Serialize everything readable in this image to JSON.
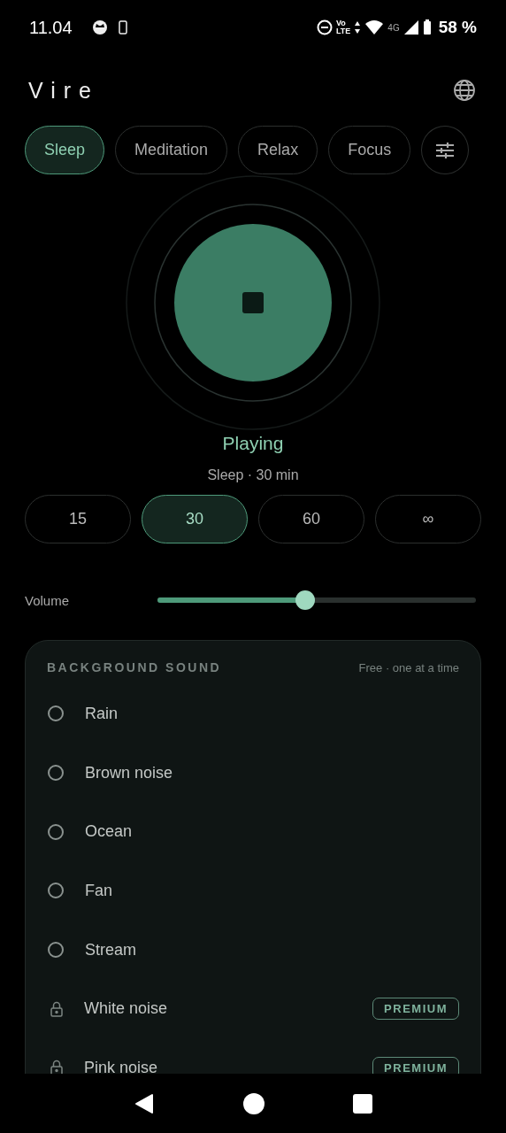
{
  "status_bar": {
    "time": "11.04",
    "volte": "Vo",
    "lte": "LTE",
    "network": "4G",
    "battery": "58 %"
  },
  "app": {
    "title": "Vire"
  },
  "tabs": [
    {
      "label": "Sleep",
      "selected": true
    },
    {
      "label": "Meditation",
      "selected": false
    },
    {
      "label": "Relax",
      "selected": false
    },
    {
      "label": "Focus",
      "selected": false
    }
  ],
  "player": {
    "playing": true,
    "status": "Playing",
    "subtitle": "Sleep · 30 min"
  },
  "timers": [
    {
      "label": "15",
      "selected": false
    },
    {
      "label": "30",
      "selected": true
    },
    {
      "label": "60",
      "selected": false
    },
    {
      "label": "∞",
      "selected": false
    }
  ],
  "volume": {
    "label": "Volume",
    "level": 0.465
  },
  "background_sound": {
    "title": "BACKGROUND SOUND",
    "note": "Free · one at a time",
    "items": [
      {
        "kind": "radio",
        "label": "Rain",
        "selected": false
      },
      {
        "kind": "radio",
        "label": "Brown noise",
        "selected": false
      },
      {
        "kind": "radio",
        "label": "Ocean",
        "selected": false
      },
      {
        "kind": "radio",
        "label": "Fan",
        "selected": false
      },
      {
        "kind": "radio",
        "label": "Stream",
        "selected": false
      },
      {
        "kind": "locked",
        "label": "White noise",
        "badge": "PREMIUM"
      },
      {
        "kind": "locked",
        "label": "Pink noise",
        "badge": "PREMIUM"
      }
    ]
  }
}
